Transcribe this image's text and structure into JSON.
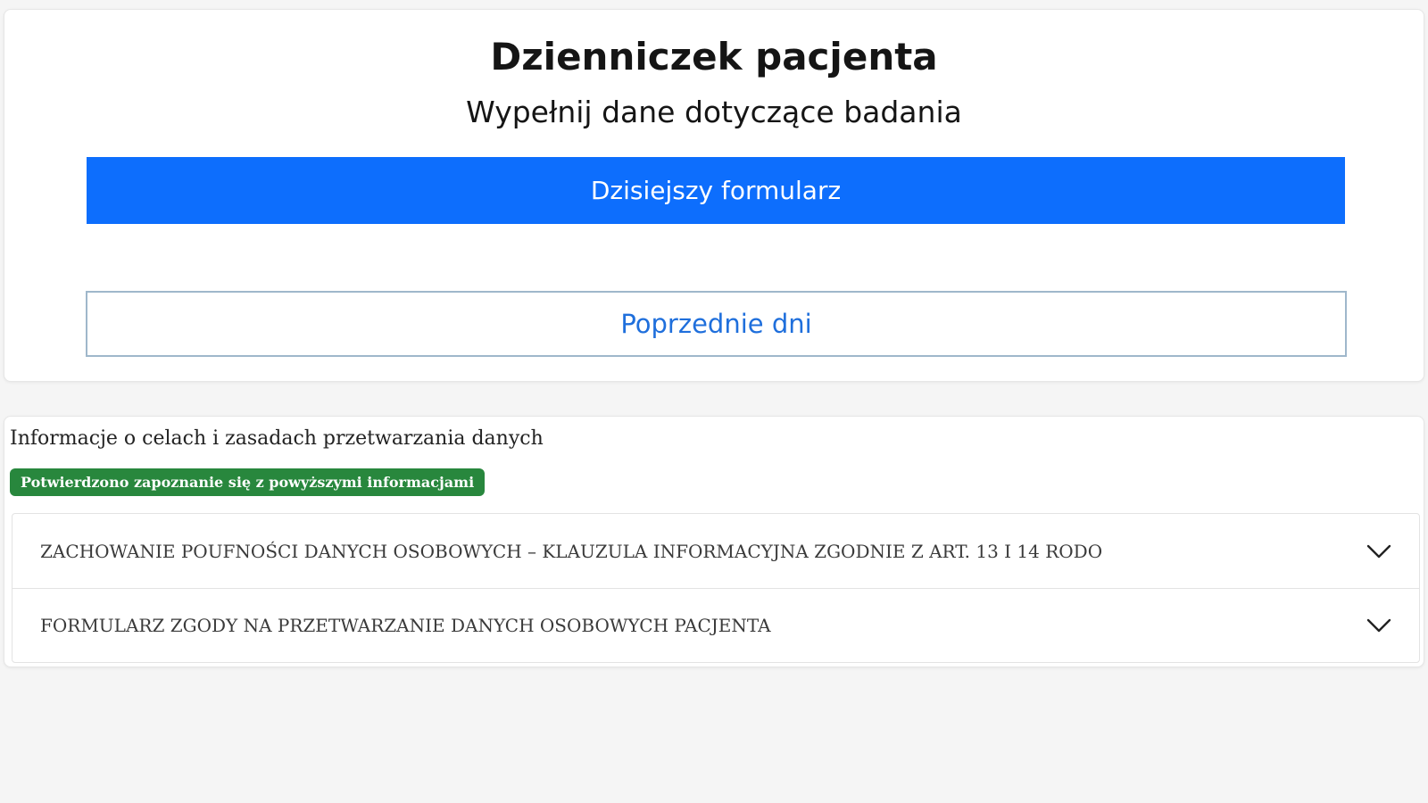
{
  "header": {
    "title": "Dzienniczek pacjenta",
    "subtitle": "Wypełnij dane dotyczące badania"
  },
  "actions": {
    "today_form_label": "Dzisiejszy formularz",
    "previous_days_label": "Poprzednie dni"
  },
  "info_section": {
    "heading": "Informacje o celach i zasadach przetwarzania danych",
    "badge": "Potwierdzono zapoznanie się z powyższymi informacjami",
    "accordion": [
      {
        "label": "ZACHOWANIE POUFNOŚCI DANYCH OSOBOWYCH – KLAUZULA INFORMACYJNA ZGODNIE Z ART. 13 I 14 RODO",
        "icon": "chevron-down-icon"
      },
      {
        "label": "FORMULARZ ZGODY NA PRZETWARZANIE DANYCH OSOBOWYCH PACJENTA",
        "icon": "chevron-down-icon"
      }
    ]
  },
  "colors": {
    "primary": "#0d6efd",
    "success": "#28873d",
    "outline_text": "#1f6fdc",
    "background": "#f5f5f5"
  }
}
